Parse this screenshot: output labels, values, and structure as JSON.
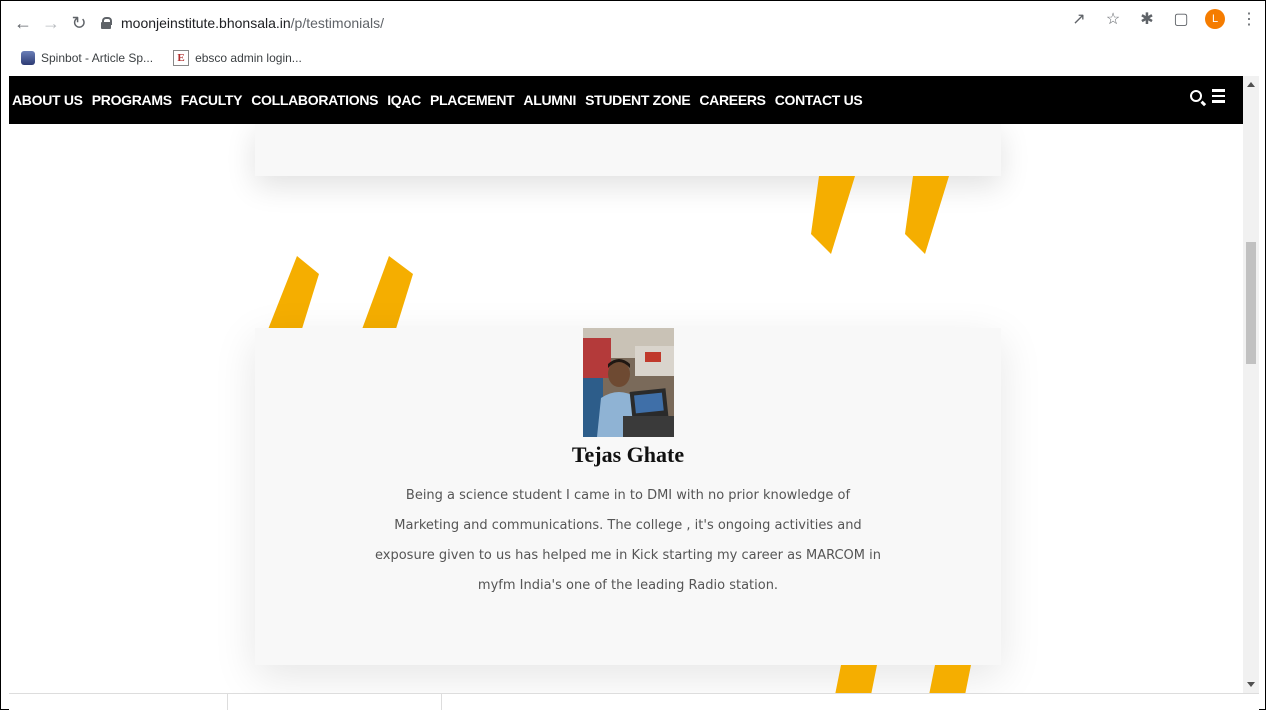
{
  "browser": {
    "url_host": "moonjeinstitute.bhonsala.in",
    "url_path": "/p/testimonials/",
    "profile_initial": "L",
    "bookmarks": [
      {
        "label": "Spinbot - Article Sp..."
      },
      {
        "label": "ebsco admin login..."
      }
    ],
    "bookmark2_icon_letter": "E"
  },
  "site_nav": {
    "items": [
      "ABOUT US",
      "PROGRAMS",
      "FACULTY",
      "COLLABORATIONS",
      "IQAC",
      "PLACEMENT",
      "ALUMNI",
      "STUDENT ZONE",
      "CAREERS",
      "CONTACT US"
    ]
  },
  "testimonial": {
    "name": "Tejas Ghate",
    "text": "Being a science student I came in to DMI with no prior knowledge of Marketing and communications. The college , it's ongoing activities and exposure given to us has helped me in Kick starting my career as MARCOM in myfm India's one of the leading Radio station."
  },
  "colors": {
    "quote_accent": "#F5AE00",
    "nav_bg": "#000000",
    "card_bg": "#F8F8F8"
  },
  "icons": [
    "back-icon",
    "forward-icon",
    "reload-icon",
    "lock-icon",
    "share-icon",
    "star-icon",
    "extensions-icon",
    "side-panel-icon",
    "menu-dots-icon",
    "search-icon",
    "hamburger-menu-icon"
  ]
}
